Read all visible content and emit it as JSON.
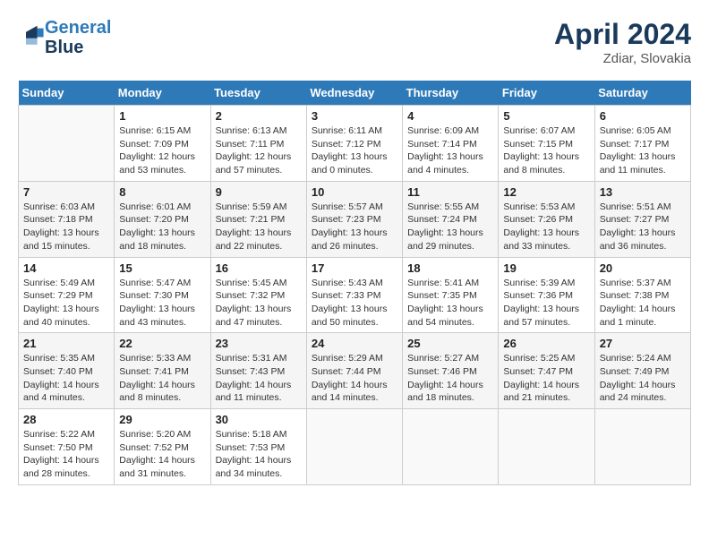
{
  "header": {
    "logo_line1": "General",
    "logo_line2": "Blue",
    "month": "April 2024",
    "location": "Zdiar, Slovakia"
  },
  "weekdays": [
    "Sunday",
    "Monday",
    "Tuesday",
    "Wednesday",
    "Thursday",
    "Friday",
    "Saturday"
  ],
  "weeks": [
    [
      {
        "day": "",
        "info": ""
      },
      {
        "day": "1",
        "info": "Sunrise: 6:15 AM\nSunset: 7:09 PM\nDaylight: 12 hours\nand 53 minutes."
      },
      {
        "day": "2",
        "info": "Sunrise: 6:13 AM\nSunset: 7:11 PM\nDaylight: 12 hours\nand 57 minutes."
      },
      {
        "day": "3",
        "info": "Sunrise: 6:11 AM\nSunset: 7:12 PM\nDaylight: 13 hours\nand 0 minutes."
      },
      {
        "day": "4",
        "info": "Sunrise: 6:09 AM\nSunset: 7:14 PM\nDaylight: 13 hours\nand 4 minutes."
      },
      {
        "day": "5",
        "info": "Sunrise: 6:07 AM\nSunset: 7:15 PM\nDaylight: 13 hours\nand 8 minutes."
      },
      {
        "day": "6",
        "info": "Sunrise: 6:05 AM\nSunset: 7:17 PM\nDaylight: 13 hours\nand 11 minutes."
      }
    ],
    [
      {
        "day": "7",
        "info": "Sunrise: 6:03 AM\nSunset: 7:18 PM\nDaylight: 13 hours\nand 15 minutes."
      },
      {
        "day": "8",
        "info": "Sunrise: 6:01 AM\nSunset: 7:20 PM\nDaylight: 13 hours\nand 18 minutes."
      },
      {
        "day": "9",
        "info": "Sunrise: 5:59 AM\nSunset: 7:21 PM\nDaylight: 13 hours\nand 22 minutes."
      },
      {
        "day": "10",
        "info": "Sunrise: 5:57 AM\nSunset: 7:23 PM\nDaylight: 13 hours\nand 26 minutes."
      },
      {
        "day": "11",
        "info": "Sunrise: 5:55 AM\nSunset: 7:24 PM\nDaylight: 13 hours\nand 29 minutes."
      },
      {
        "day": "12",
        "info": "Sunrise: 5:53 AM\nSunset: 7:26 PM\nDaylight: 13 hours\nand 33 minutes."
      },
      {
        "day": "13",
        "info": "Sunrise: 5:51 AM\nSunset: 7:27 PM\nDaylight: 13 hours\nand 36 minutes."
      }
    ],
    [
      {
        "day": "14",
        "info": "Sunrise: 5:49 AM\nSunset: 7:29 PM\nDaylight: 13 hours\nand 40 minutes."
      },
      {
        "day": "15",
        "info": "Sunrise: 5:47 AM\nSunset: 7:30 PM\nDaylight: 13 hours\nand 43 minutes."
      },
      {
        "day": "16",
        "info": "Sunrise: 5:45 AM\nSunset: 7:32 PM\nDaylight: 13 hours\nand 47 minutes."
      },
      {
        "day": "17",
        "info": "Sunrise: 5:43 AM\nSunset: 7:33 PM\nDaylight: 13 hours\nand 50 minutes."
      },
      {
        "day": "18",
        "info": "Sunrise: 5:41 AM\nSunset: 7:35 PM\nDaylight: 13 hours\nand 54 minutes."
      },
      {
        "day": "19",
        "info": "Sunrise: 5:39 AM\nSunset: 7:36 PM\nDaylight: 13 hours\nand 57 minutes."
      },
      {
        "day": "20",
        "info": "Sunrise: 5:37 AM\nSunset: 7:38 PM\nDaylight: 14 hours\nand 1 minute."
      }
    ],
    [
      {
        "day": "21",
        "info": "Sunrise: 5:35 AM\nSunset: 7:40 PM\nDaylight: 14 hours\nand 4 minutes."
      },
      {
        "day": "22",
        "info": "Sunrise: 5:33 AM\nSunset: 7:41 PM\nDaylight: 14 hours\nand 8 minutes."
      },
      {
        "day": "23",
        "info": "Sunrise: 5:31 AM\nSunset: 7:43 PM\nDaylight: 14 hours\nand 11 minutes."
      },
      {
        "day": "24",
        "info": "Sunrise: 5:29 AM\nSunset: 7:44 PM\nDaylight: 14 hours\nand 14 minutes."
      },
      {
        "day": "25",
        "info": "Sunrise: 5:27 AM\nSunset: 7:46 PM\nDaylight: 14 hours\nand 18 minutes."
      },
      {
        "day": "26",
        "info": "Sunrise: 5:25 AM\nSunset: 7:47 PM\nDaylight: 14 hours\nand 21 minutes."
      },
      {
        "day": "27",
        "info": "Sunrise: 5:24 AM\nSunset: 7:49 PM\nDaylight: 14 hours\nand 24 minutes."
      }
    ],
    [
      {
        "day": "28",
        "info": "Sunrise: 5:22 AM\nSunset: 7:50 PM\nDaylight: 14 hours\nand 28 minutes."
      },
      {
        "day": "29",
        "info": "Sunrise: 5:20 AM\nSunset: 7:52 PM\nDaylight: 14 hours\nand 31 minutes."
      },
      {
        "day": "30",
        "info": "Sunrise: 5:18 AM\nSunset: 7:53 PM\nDaylight: 14 hours\nand 34 minutes."
      },
      {
        "day": "",
        "info": ""
      },
      {
        "day": "",
        "info": ""
      },
      {
        "day": "",
        "info": ""
      },
      {
        "day": "",
        "info": ""
      }
    ]
  ]
}
